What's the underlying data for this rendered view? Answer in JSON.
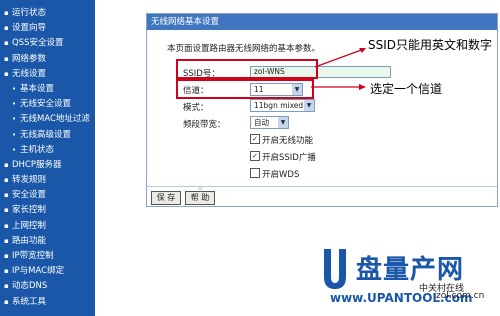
{
  "sidebar": {
    "items": [
      {
        "label": "运行状态",
        "sub": false
      },
      {
        "label": "设置向导",
        "sub": false
      },
      {
        "label": "QSS安全设置",
        "sub": false
      },
      {
        "label": "网络参数",
        "sub": false
      },
      {
        "label": "无线设置",
        "sub": false
      },
      {
        "label": "基本设置",
        "sub": true
      },
      {
        "label": "无线安全设置",
        "sub": true
      },
      {
        "label": "无线MAC地址过滤",
        "sub": true
      },
      {
        "label": "无线高级设置",
        "sub": true
      },
      {
        "label": "主机状态",
        "sub": true
      },
      {
        "label": "DHCP服务器",
        "sub": false
      },
      {
        "label": "转发规则",
        "sub": false
      },
      {
        "label": "安全设置",
        "sub": false
      },
      {
        "label": "家长控制",
        "sub": false
      },
      {
        "label": "上网控制",
        "sub": false
      },
      {
        "label": "路由功能",
        "sub": false
      },
      {
        "label": "IP带宽控制",
        "sub": false
      },
      {
        "label": "IP与MAC绑定",
        "sub": false
      },
      {
        "label": "动态DNS",
        "sub": false
      },
      {
        "label": "系统工具",
        "sub": false
      }
    ]
  },
  "panel": {
    "title": "无线网络基本设置",
    "intro": "本页面设置路由器无线网络的基本参数。",
    "ssid_label": "SSID号：",
    "ssid_value": "zol-WNS",
    "channel_label": "信道：",
    "channel_value": "11",
    "mode_label": "模式：",
    "mode_value": "11bgn mixed",
    "bandwidth_label": "频段带宽：",
    "bandwidth_value": "自动",
    "enable_wireless": "开启无线功能",
    "enable_ssid_broadcast": "开启SSID广播",
    "enable_wds": "开启WDS",
    "save_button": "保 存",
    "help_button": "帮 助"
  },
  "annotations": {
    "ssid_note": "SSID只能用英文和数字",
    "channel_note": "选定一个信道"
  },
  "logo": {
    "brand": "盘量产网",
    "url": "www.UPANTOOL.com",
    "site1": "中关村在线",
    "site2": "zol.com.cn"
  },
  "colors": {
    "sidebar": "#1a57a8",
    "header": "#3f76bf",
    "annotation_box": "#d0021b"
  }
}
